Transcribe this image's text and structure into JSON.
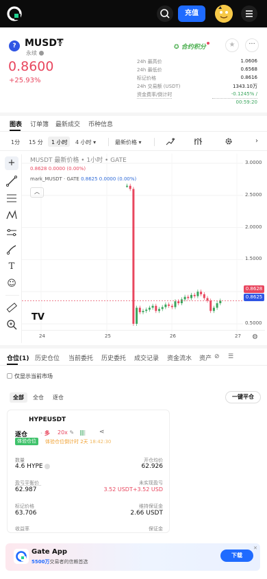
{
  "topbar": {
    "charge_label": "充值"
  },
  "header": {
    "symbol": "MUSDT",
    "contract_type": "永续",
    "last_price": "0.8600",
    "change_pct": "+25.93%",
    "points_label": "合约积分",
    "stats": [
      {
        "label": "24h 最高价",
        "value": "1.0606"
      },
      {
        "label": "24h 最低价",
        "value": "0.6568"
      },
      {
        "label": "标记价格",
        "value": "0.8616"
      },
      {
        "label": "24h 交易额 (USDT)",
        "value": "1343.10万"
      }
    ],
    "funding_label": "资金费率/倒计时",
    "funding_rate": "-0.1245% /",
    "funding_countdown": "00:59:20"
  },
  "tabs": [
    "图表",
    "订单簿",
    "最新成交",
    "币种信息"
  ],
  "intervals": {
    "items": [
      "1分",
      "15 分",
      "1 小时",
      "4 小时 ▾"
    ],
    "active": "1 小时",
    "price_type": "最新价格 ▾"
  },
  "chart": {
    "title": "MUSDT 最新价格 • 1小时 • GATE",
    "legend_latest": "0.8628  0.0000 (0.00%)",
    "legend_mark_name": "mark_MUSDT · GATE",
    "legend_mark_values": "0.8625  0.0000 (0.00%)",
    "last_price_tag": "0.8628",
    "mark_price_tag": "0.8625",
    "tv_logo": "TV"
  },
  "chart_data": {
    "type": "line",
    "title": "MUSDT 最新价格 • 1小时 • GATE",
    "ylim": [
      0.35,
      3.15
    ],
    "y_ticks": [
      "3.0000",
      "2.5000",
      "2.0000",
      "1.5000",
      "1.0000",
      "0.5000"
    ],
    "x_ticks": [
      "24",
      "25",
      "26",
      "27"
    ],
    "series": [
      {
        "name": "最新价格",
        "values": [
          2.65,
          2.6,
          0.5,
          0.75,
          0.68,
          0.7,
          0.72,
          0.75,
          0.78,
          0.7,
          0.73,
          0.76,
          0.8,
          0.78,
          0.76,
          0.85,
          0.82,
          0.88,
          0.92,
          0.9,
          0.95,
          0.93,
          1.0,
          0.96,
          0.9,
          0.86,
          0.7,
          0.75,
          0.82,
          0.86
        ]
      }
    ],
    "grid": true
  },
  "positions": {
    "tabs": [
      "仓位(1)",
      "历史仓位",
      "当前委托",
      "历史委托",
      "成交记录",
      "资金流水",
      "资产"
    ],
    "only_current": "仅显示当前市场",
    "filters": [
      "全部",
      "全仓",
      "逐仓"
    ],
    "close_all": "一键平仓",
    "card": {
      "symbol": "HYPEUSDT",
      "margin_mode": "逐仓",
      "side": "多",
      "leverage": "20x",
      "badge": "体验仓位",
      "note": "体验仓位倒计时 2天",
      "note_time": "18:42:30",
      "fields": {
        "qty_label": "数量",
        "qty_value": "4.6 HYPE",
        "entry_label": "开仓均价",
        "entry_value": "62.926",
        "breakeven_label": "盈亏平衡价",
        "breakeven_value": "62.987",
        "upnl_label": "未实现盈亏",
        "upnl_value": "3.52 USDT+3.52 USD",
        "mark_label": "标记价格",
        "mark_value": "63.706",
        "margin_label": "维持保证金",
        "margin_value": "2.66 USDT",
        "roe_label": "收益率",
        "collateral_label": "保证金"
      }
    }
  },
  "banner": {
    "title": "Gate App",
    "sub_highlight": "5500万",
    "sub_rest": "交易者的信赖首选",
    "download": "下载",
    "close": "✕"
  },
  "colors": {
    "accent": "#1f6bff",
    "down": "#e8465e",
    "up": "#3aa55d"
  }
}
